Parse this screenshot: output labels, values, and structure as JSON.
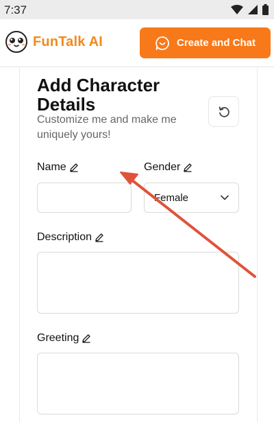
{
  "status_bar": {
    "time": "7:37"
  },
  "header": {
    "brand": "FunTalk AI",
    "cta_label": "Create and Chat"
  },
  "form": {
    "title": "Add Character Details",
    "subtitle": "Customize me and make me uniquely yours!",
    "name_label": "Name",
    "name_value": "",
    "gender_label": "Gender",
    "gender_selected": "Female",
    "description_label": "Description",
    "description_value": "",
    "greeting_label": "Greeting",
    "greeting_value": ""
  },
  "colors": {
    "accent": "#f7791a",
    "brand_text": "#f08a1c",
    "annotation_arrow": "#e0533a"
  },
  "icons": [
    "wifi-icon",
    "signal-icon",
    "battery-icon",
    "smile-face-icon",
    "chat-bubble-icon",
    "reset-icon",
    "pencil-icon",
    "chevron-down-icon"
  ]
}
